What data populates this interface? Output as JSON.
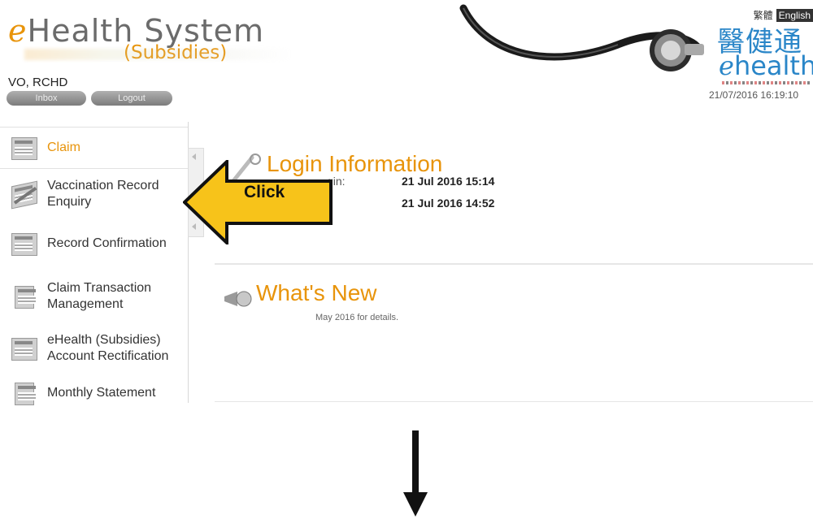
{
  "header": {
    "logo_main": "Health System",
    "logo_e": "e",
    "logo_sub": "(Subsidies)",
    "user": "VO, RCHD",
    "inbox": "Inbox",
    "logout": "Logout",
    "lang_tc": "繁體",
    "lang_en": "English",
    "brand_cn": "醫健通",
    "brand_en_e": "e",
    "brand_en_rest": "health",
    "datetime": "21/07/2016 16:19:10"
  },
  "sidebar": {
    "items": [
      {
        "label": "Claim",
        "icon": "claim-icon"
      },
      {
        "label": "Vaccination Record Enquiry",
        "icon": "vaccination-record-icon"
      },
      {
        "label": "Record Confirmation",
        "icon": "record-confirmation-icon"
      },
      {
        "label": "Claim Transaction Management",
        "icon": "claim-transaction-icon"
      },
      {
        "label": "eHealth (Subsidies) Account Rectification",
        "icon": "account-rectification-icon"
      },
      {
        "label": "Monthly Statement",
        "icon": "monthly-statement-icon"
      }
    ]
  },
  "login_info": {
    "title": "Login Information",
    "label_fragment": "gin:",
    "last_login": "21 Jul 2016 15:14",
    "prev_login": "21 Jul 2016 14:52"
  },
  "whats_new": {
    "title": "What's New",
    "text": "May 2016 for details."
  },
  "callout": {
    "text": "Click"
  },
  "colors": {
    "accent": "#e8940b",
    "brand": "#2a86c8",
    "callout_fill": "#f7c31a"
  }
}
